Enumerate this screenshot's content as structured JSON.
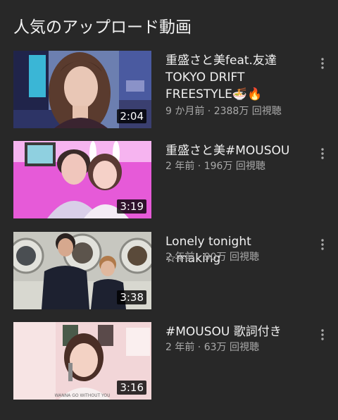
{
  "section": {
    "title": "人気のアップロード動画"
  },
  "videos": [
    {
      "title": "重盛さと美feat.友達 TOKYO DRIFT FREESTYLE🍜🔥",
      "meta": "9 か月前 · 2388万 回視聴",
      "duration": "2:04",
      "thumbnail_icon": "woman-portrait-blue-room"
    },
    {
      "title": "重盛さと美#MOUSOU",
      "meta": "2 年前 · 196万 回視聴",
      "duration": "3:19",
      "thumbnail_icon": "couple-bunny-ears-pink"
    },
    {
      "title": "Lonely tonight ☆making",
      "meta": "2 年前 · 90万 回視聴",
      "duration": "3:38",
      "thumbnail_icon": "couple-laundromat-usa-sweaters"
    },
    {
      "title": "#MOUSOU 歌詞付き",
      "meta": "2 年前 · 63万 回視聴",
      "duration": "3:16",
      "thumbnail_icon": "woman-singing-microphone"
    }
  ],
  "thumbnail_text": {
    "video4_caption": "WANNA GO WITHOUT YOU"
  },
  "colors": {
    "background": "#282828",
    "primary_text": "#f1f1f1",
    "secondary_text": "#aaaaaa"
  }
}
